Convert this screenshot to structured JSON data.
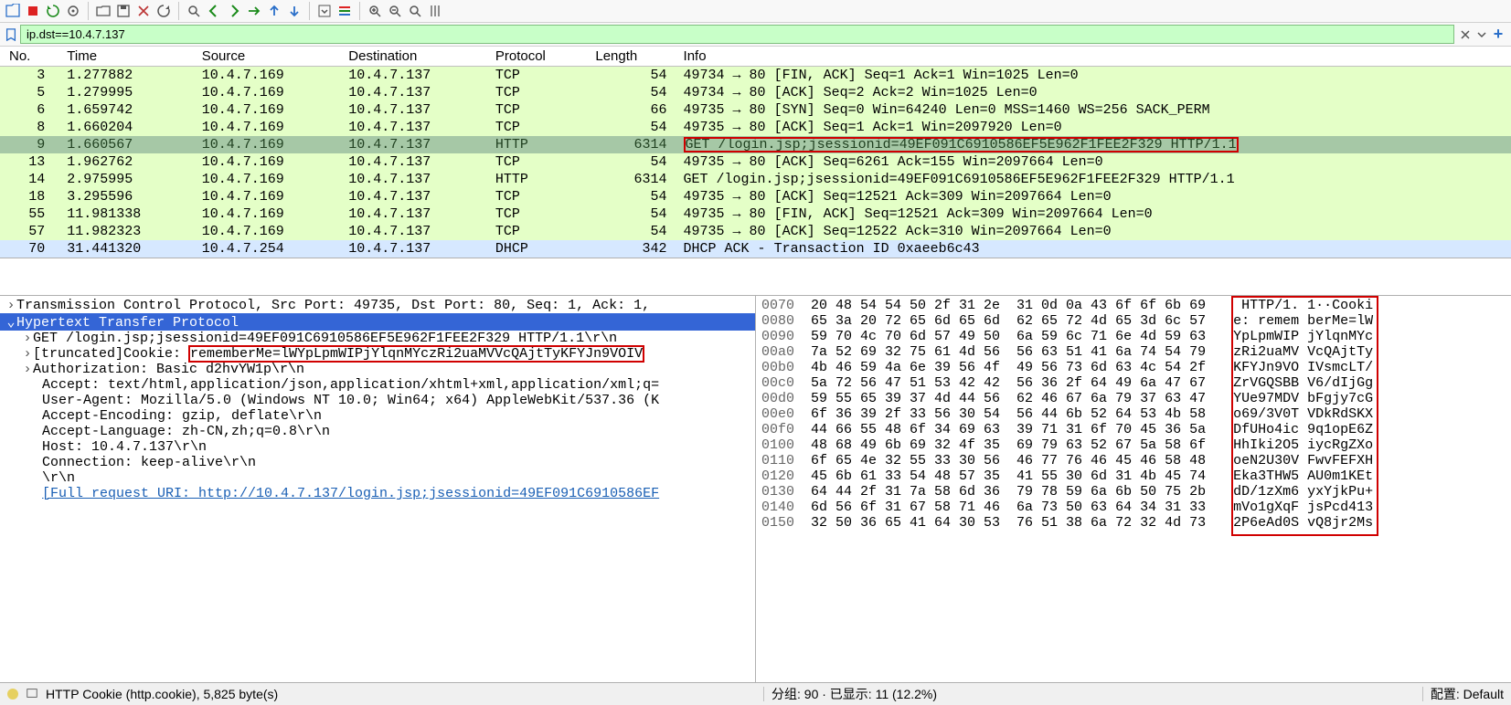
{
  "filter": {
    "value": "ip.dst==10.4.7.137"
  },
  "columns": [
    "No.",
    "Time",
    "Source",
    "Destination",
    "Protocol",
    "Length",
    "Info"
  ],
  "packets": [
    {
      "no": "3",
      "time": "1.277882",
      "src": "10.4.7.169",
      "dst": "10.4.7.137",
      "proto": "TCP",
      "len": "54",
      "info": "49734 → 80 [FIN, ACK] Seq=1 Ack=1 Win=1025 Len=0",
      "cls": "row-green"
    },
    {
      "no": "5",
      "time": "1.279995",
      "src": "10.4.7.169",
      "dst": "10.4.7.137",
      "proto": "TCP",
      "len": "54",
      "info": "49734 → 80 [ACK] Seq=2 Ack=2 Win=1025 Len=0",
      "cls": "row-green"
    },
    {
      "no": "6",
      "time": "1.659742",
      "src": "10.4.7.169",
      "dst": "10.4.7.137",
      "proto": "TCP",
      "len": "66",
      "info": "49735 → 80 [SYN] Seq=0 Win=64240 Len=0 MSS=1460 WS=256 SACK_PERM",
      "cls": "row-green"
    },
    {
      "no": "8",
      "time": "1.660204",
      "src": "10.4.7.169",
      "dst": "10.4.7.137",
      "proto": "TCP",
      "len": "54",
      "info": "49735 → 80 [ACK] Seq=1 Ack=1 Win=2097920 Len=0",
      "cls": "row-green"
    },
    {
      "no": "9",
      "time": "1.660567",
      "src": "10.4.7.169",
      "dst": "10.4.7.137",
      "proto": "HTTP",
      "len": "6314",
      "info": "GET /login.jsp;jsessionid=49EF091C6910586EF5E962F1FEE2F329 HTTP/1.1 ",
      "cls": "row-sel",
      "hlinfo": true
    },
    {
      "no": "13",
      "time": "1.962762",
      "src": "10.4.7.169",
      "dst": "10.4.7.137",
      "proto": "TCP",
      "len": "54",
      "info": "49735 → 80 [ACK] Seq=6261 Ack=155 Win=2097664 Len=0",
      "cls": "row-green"
    },
    {
      "no": "14",
      "time": "2.975995",
      "src": "10.4.7.169",
      "dst": "10.4.7.137",
      "proto": "HTTP",
      "len": "6314",
      "info": "GET /login.jsp;jsessionid=49EF091C6910586EF5E962F1FEE2F329 HTTP/1.1 ",
      "cls": "row-green"
    },
    {
      "no": "18",
      "time": "3.295596",
      "src": "10.4.7.169",
      "dst": "10.4.7.137",
      "proto": "TCP",
      "len": "54",
      "info": "49735 → 80 [ACK] Seq=12521 Ack=309 Win=2097664 Len=0",
      "cls": "row-green"
    },
    {
      "no": "55",
      "time": "11.981338",
      "src": "10.4.7.169",
      "dst": "10.4.7.137",
      "proto": "TCP",
      "len": "54",
      "info": "49735 → 80 [FIN, ACK] Seq=12521 Ack=309 Win=2097664 Len=0",
      "cls": "row-green"
    },
    {
      "no": "57",
      "time": "11.982323",
      "src": "10.4.7.169",
      "dst": "10.4.7.137",
      "proto": "TCP",
      "len": "54",
      "info": "49735 → 80 [ACK] Seq=12522 Ack=310 Win=2097664 Len=0",
      "cls": "row-green"
    },
    {
      "no": "70",
      "time": "31.441320",
      "src": "10.4.7.254",
      "dst": "10.4.7.137",
      "proto": "DHCP",
      "len": "342",
      "info": "DHCP ACK      - Transaction ID 0xaeeb6c43",
      "cls": "row-blue"
    }
  ],
  "details": {
    "tcp": "Transmission Control Protocol, Src Port: 49735, Dst Port: 80, Seq: 1, Ack: 1,",
    "http": "Hypertext Transfer Protocol",
    "get_line": "GET /login.jsp;jsessionid=49EF091C6910586EF5E962F1FEE2F329 HTTP/1.1\\r\\n",
    "cookie_prefix": "[truncated]Cookie: ",
    "cookie_val": "rememberMe=lWYpLpmWIPjYlqnMYczRi2uaMVVcQAjtTyKFYJn9VOIV",
    "auth": "Authorization: Basic d2hvYW1p\\r\\n",
    "accept": "Accept: text/html,application/json,application/xhtml+xml,application/xml;q=",
    "ua": "User-Agent: Mozilla/5.0 (Windows NT 10.0; Win64; x64) AppleWebKit/537.36 (K",
    "accenc": "Accept-Encoding: gzip, deflate\\r\\n",
    "acclang": "Accept-Language: zh-CN,zh;q=0.8\\r\\n",
    "host": "Host: 10.4.7.137\\r\\n",
    "conn": "Connection: keep-alive\\r\\n",
    "crlf": "\\r\\n",
    "full_uri": "[Full request URI: http://10.4.7.137/login.jsp;jsessionid=49EF091C6910586EF"
  },
  "hex": [
    {
      "off": "0070",
      "b1": "20 48 54 54 50 2f 31 2e",
      "b2": "31 0d 0a 43 6f 6f 6b 69",
      "a1": " HTTP/1. ",
      "a2": "1··Cooki"
    },
    {
      "off": "0080",
      "b1": "65 3a 20 72 65 6d 65 6d",
      "b2": "62 65 72 4d 65 3d 6c 57",
      "a1": "e: remem ",
      "a2": "berMe=lW"
    },
    {
      "off": "0090",
      "b1": "59 70 4c 70 6d 57 49 50",
      "b2": "6a 59 6c 71 6e 4d 59 63",
      "a1": "YpLpmWIP ",
      "a2": "jYlqnMYc"
    },
    {
      "off": "00a0",
      "b1": "7a 52 69 32 75 61 4d 56",
      "b2": "56 63 51 41 6a 74 54 79",
      "a1": "zRi2uaMV ",
      "a2": "VcQAjtTy"
    },
    {
      "off": "00b0",
      "b1": "4b 46 59 4a 6e 39 56 4f",
      "b2": "49 56 73 6d 63 4c 54 2f",
      "a1": "KFYJn9VO ",
      "a2": "IVsmcLT/"
    },
    {
      "off": "00c0",
      "b1": "5a 72 56 47 51 53 42 42",
      "b2": "56 36 2f 64 49 6a 47 67",
      "a1": "ZrVGQSBB ",
      "a2": "V6/dIjGg"
    },
    {
      "off": "00d0",
      "b1": "59 55 65 39 37 4d 44 56",
      "b2": "62 46 67 6a 79 37 63 47",
      "a1": "YUe97MDV ",
      "a2": "bFgjy7cG"
    },
    {
      "off": "00e0",
      "b1": "6f 36 39 2f 33 56 30 54",
      "b2": "56 44 6b 52 64 53 4b 58",
      "a1": "o69/3V0T ",
      "a2": "VDkRdSKX"
    },
    {
      "off": "00f0",
      "b1": "44 66 55 48 6f 34 69 63",
      "b2": "39 71 31 6f 70 45 36 5a",
      "a1": "DfUHo4ic ",
      "a2": "9q1opE6Z"
    },
    {
      "off": "0100",
      "b1": "48 68 49 6b 69 32 4f 35",
      "b2": "69 79 63 52 67 5a 58 6f",
      "a1": "HhIki2O5 ",
      "a2": "iycRgZXo"
    },
    {
      "off": "0110",
      "b1": "6f 65 4e 32 55 33 30 56",
      "b2": "46 77 76 46 45 46 58 48",
      "a1": "oeN2U30V ",
      "a2": "FwvFEFXH"
    },
    {
      "off": "0120",
      "b1": "45 6b 61 33 54 48 57 35",
      "b2": "41 55 30 6d 31 4b 45 74",
      "a1": "Eka3THW5 ",
      "a2": "AU0m1KEt"
    },
    {
      "off": "0130",
      "b1": "64 44 2f 31 7a 58 6d 36",
      "b2": "79 78 59 6a 6b 50 75 2b",
      "a1": "dD/1zXm6 ",
      "a2": "yxYjkPu+"
    },
    {
      "off": "0140",
      "b1": "6d 56 6f 31 67 58 71 46",
      "b2": "6a 73 50 63 64 34 31 33",
      "a1": "mVo1gXqF ",
      "a2": "jsPcd413"
    },
    {
      "off": "0150",
      "b1": "32 50 36 65 41 64 30 53",
      "b2": "76 51 38 6a 72 32 4d 73",
      "a1": "2P6eAd0S ",
      "a2": "vQ8jr2Ms"
    }
  ],
  "status": {
    "left": "HTTP Cookie (http.cookie), 5,825 byte(s)",
    "mid": "分组: 90 · 已显示: 11 (12.2%)",
    "right": "配置: Default"
  }
}
